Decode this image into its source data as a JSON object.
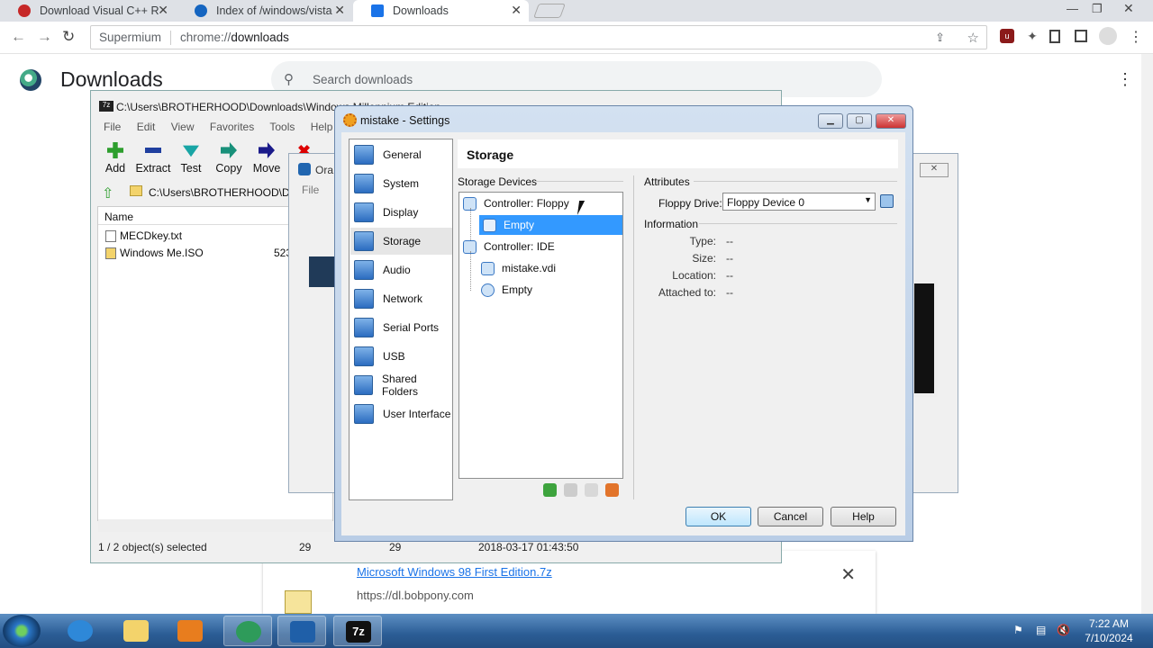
{
  "browser": {
    "tabs": [
      {
        "title": "Download Visual C++ R",
        "icon_color": "#c62828"
      },
      {
        "title": "Index of /windows/vista",
        "icon_color": "#1565c0"
      },
      {
        "title": "Downloads",
        "icon_color": "#1a73e8"
      }
    ],
    "omnibox": {
      "site": "Supermium",
      "url_scheme": "chrome://",
      "url_path": "downloads"
    }
  },
  "downloads_page": {
    "title": "Downloads",
    "search_placeholder": "Search downloads",
    "item": {
      "filename": "Microsoft Windows 98 First Edition.7z",
      "url": "https://dl.bobpony.com"
    }
  },
  "sevenzip": {
    "title": "C:\\Users\\BROTHERHOOD\\Downloads\\Windows Millennium Edition",
    "menu": [
      "File",
      "Edit",
      "View",
      "Favorites",
      "Tools",
      "Help"
    ],
    "toolbar": [
      "Add",
      "Extract",
      "Test",
      "Copy",
      "Move"
    ],
    "path": "C:\\Users\\BROTHERHOOD\\Do",
    "column_name": "Name",
    "files": [
      {
        "name": "MECDkey.txt",
        "size": ""
      },
      {
        "name": "Windows Me.ISO",
        "size": "523"
      }
    ],
    "status": {
      "selected": "1 / 2 object(s) selected",
      "size1": "29",
      "size2": "29",
      "date": "2018-03-17 01:43:50"
    }
  },
  "oracle_window": {
    "title": "Ora",
    "menu": "File"
  },
  "settings": {
    "title": "mistake - Settings",
    "categories": [
      "General",
      "System",
      "Display",
      "Storage",
      "Audio",
      "Network",
      "Serial Ports",
      "USB",
      "Shared Folders",
      "User Interface"
    ],
    "selected_category": "Storage",
    "panel_title": "Storage",
    "storage_devices_label": "Storage Devices",
    "tree": [
      {
        "label": "Controller: Floppy",
        "level": 0
      },
      {
        "label": "Empty",
        "level": 1
      },
      {
        "label": "Controller: IDE",
        "level": 0
      },
      {
        "label": "mistake.vdi",
        "level": 1
      },
      {
        "label": "Empty",
        "level": 1
      }
    ],
    "attributes_label": "Attributes",
    "floppy_drive_label": "Floppy Drive:",
    "floppy_drive_value": "Floppy Device 0",
    "information_label": "Information",
    "info": [
      {
        "key": "Type:",
        "value": "--"
      },
      {
        "key": "Size:",
        "value": "--"
      },
      {
        "key": "Location:",
        "value": "--"
      },
      {
        "key": "Attached to:",
        "value": "--"
      }
    ],
    "buttons": {
      "ok": "OK",
      "cancel": "Cancel",
      "help": "Help"
    }
  },
  "taskbar": {
    "time": "7:22 AM",
    "date": "7/10/2024"
  }
}
